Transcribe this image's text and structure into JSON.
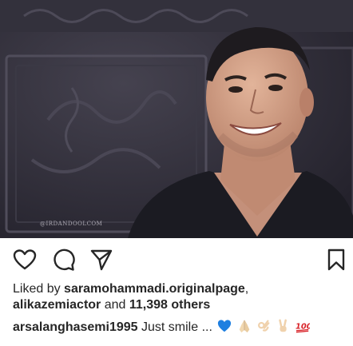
{
  "post": {
    "photo": {
      "watermark": "@IRDANDOOLCOM",
      "description_icon": "portrait-photo"
    },
    "actions": {
      "like_icon": "heart-outline-icon",
      "comment_icon": "comment-bubble-icon",
      "share_icon": "paper-plane-icon",
      "save_icon": "bookmark-outline-icon"
    },
    "likes": {
      "prefix": "Liked by ",
      "user1": "saramohammadi.originalpage",
      "separator": ",",
      "user2": "alikazemiactor",
      "middle": " and ",
      "others": "11,398 others"
    },
    "caption": {
      "username": "arsalanghasemi1995",
      "text": " Just smile ... ",
      "emojis": [
        "blue-heart-emoji",
        "folded-hands-emoji",
        "ok-hand-emoji",
        "victory-hand-emoji",
        "hundred-points-emoji"
      ]
    },
    "colors": {
      "text": "#262626",
      "photo_bg": "#2e2c37",
      "blue_heart": "#1e7fe0",
      "hundred_red": "#d9252b"
    }
  }
}
